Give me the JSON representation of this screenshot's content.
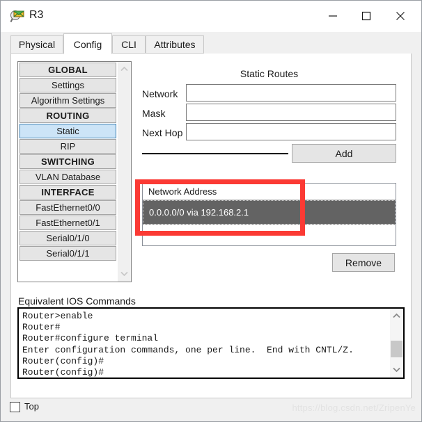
{
  "window": {
    "title": "R3",
    "icon": "packet-tracer-router-icon",
    "controls": {
      "minimize": "minimize-icon",
      "maximize": "maximize-icon",
      "close": "close-icon"
    }
  },
  "tabs": [
    {
      "label": "Physical",
      "active": false
    },
    {
      "label": "Config",
      "active": true
    },
    {
      "label": "CLI",
      "active": false
    },
    {
      "label": "Attributes",
      "active": false
    }
  ],
  "sidebar": {
    "items": [
      {
        "label": "GLOBAL",
        "type": "header",
        "selected": false
      },
      {
        "label": "Settings",
        "type": "item",
        "selected": false
      },
      {
        "label": "Algorithm Settings",
        "type": "item",
        "selected": false
      },
      {
        "label": "ROUTING",
        "type": "header",
        "selected": false
      },
      {
        "label": "Static",
        "type": "item",
        "selected": true
      },
      {
        "label": "RIP",
        "type": "item",
        "selected": false
      },
      {
        "label": "SWITCHING",
        "type": "header",
        "selected": false
      },
      {
        "label": "VLAN Database",
        "type": "item",
        "selected": false
      },
      {
        "label": "INTERFACE",
        "type": "header",
        "selected": false
      },
      {
        "label": "FastEthernet0/0",
        "type": "item",
        "selected": false
      },
      {
        "label": "FastEthernet0/1",
        "type": "item",
        "selected": false
      },
      {
        "label": "Serial0/1/0",
        "type": "item",
        "selected": false
      },
      {
        "label": "Serial0/1/1",
        "type": "item",
        "selected": false
      }
    ],
    "scroll_up": "chevron-up-icon",
    "scroll_down": "chevron-down-icon"
  },
  "static_routes": {
    "title": "Static Routes",
    "fields": [
      {
        "label": "Network",
        "value": "",
        "placeholder": ""
      },
      {
        "label": "Mask",
        "value": "",
        "placeholder": ""
      },
      {
        "label": "Next Hop",
        "value": "",
        "placeholder": ""
      }
    ],
    "add_label": "Add",
    "remove_label": "Remove",
    "list": {
      "column_header": "Network Address",
      "rows": [
        {
          "text": "0.0.0.0/0 via 192.168.2.1",
          "selected": true
        }
      ]
    }
  },
  "annotation": {
    "color": "#fb3a34",
    "target": "network-address-list-selected-route"
  },
  "ios": {
    "label": "Equivalent IOS Commands",
    "text": "Router>enable\nRouter#\nRouter#configure terminal\nEnter configuration commands, one per line.  End with CNTL/Z.\nRouter(config)#\nRouter(config)#",
    "scroll_up": "chevron-up-icon",
    "scroll_down": "chevron-down-icon"
  },
  "footer": {
    "top_checkbox_label": "Top",
    "top_checkbox_checked": false,
    "watermark": "https://blog.csdn.net/ZripenYe"
  }
}
